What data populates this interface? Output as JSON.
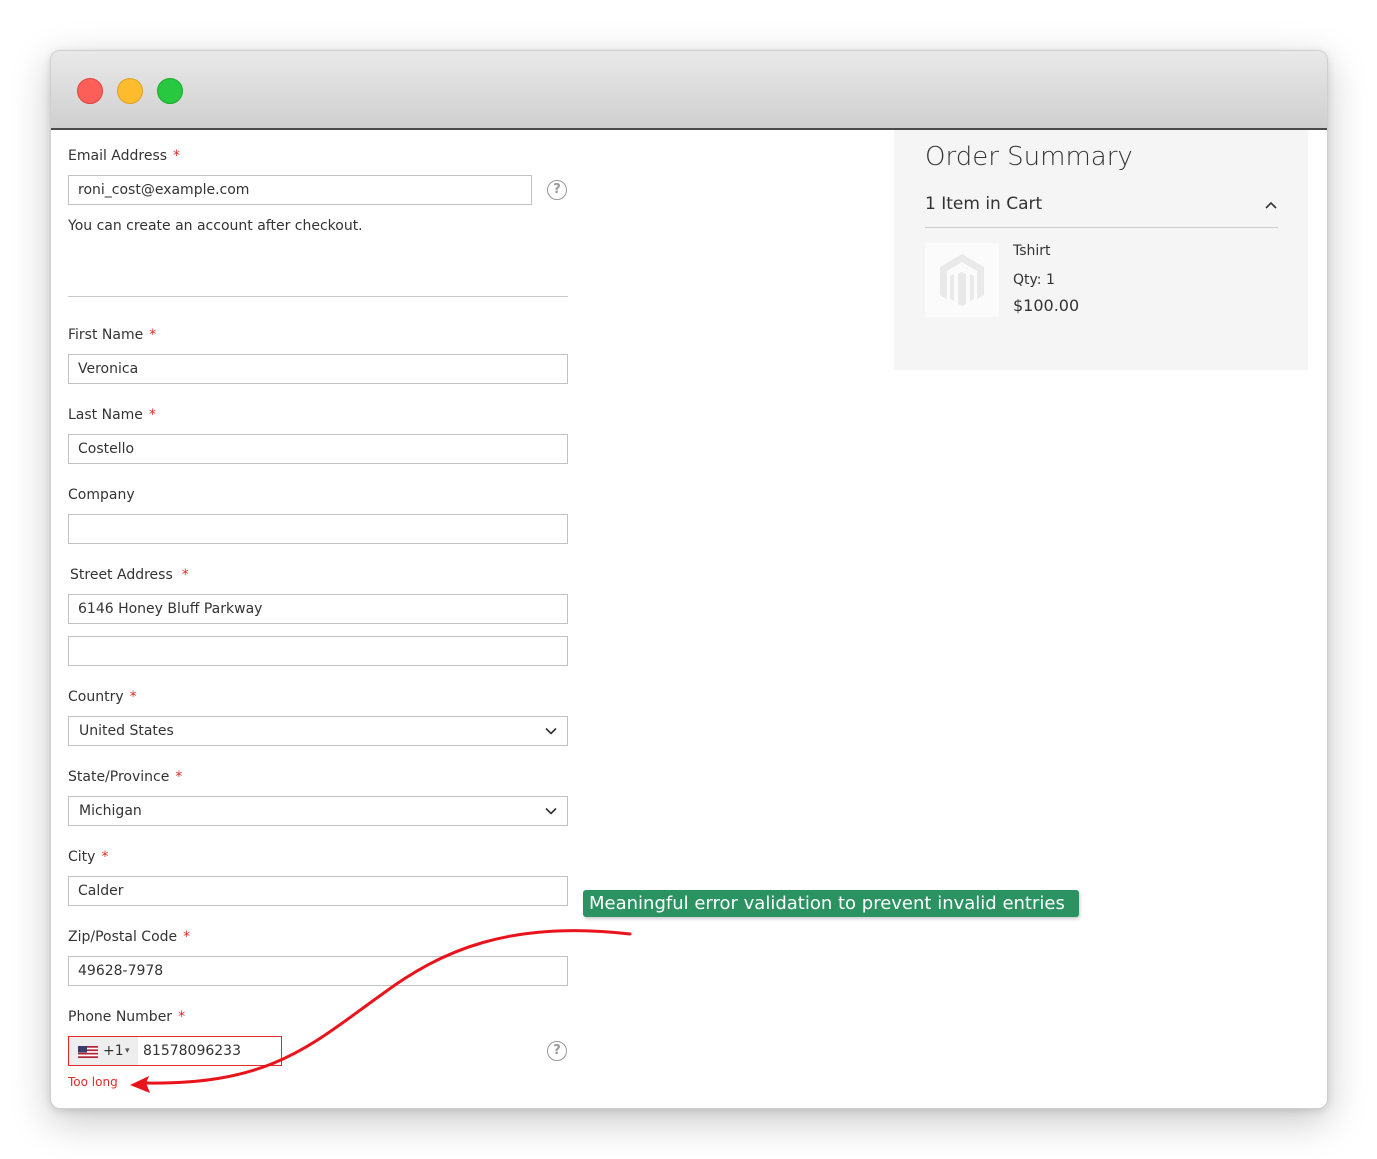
{
  "window": {
    "controls": [
      "close",
      "minimize",
      "maximize"
    ],
    "colors": {
      "close": "#fc5f57",
      "minimize": "#fdbc2e",
      "maximize": "#28c840"
    }
  },
  "form": {
    "email": {
      "label": "Email Address",
      "required": "*",
      "value": "roni_cost@example.com",
      "note": "You can create an account after checkout.",
      "help_icon": "?"
    },
    "first_name": {
      "label": "First Name",
      "required": "*",
      "value": "Veronica"
    },
    "last_name": {
      "label": "Last Name",
      "required": "*",
      "value": "Costello"
    },
    "company": {
      "label": "Company",
      "value": ""
    },
    "street": {
      "label": "Street Address",
      "required": "*",
      "line1": "6146 Honey Bluff Parkway",
      "line2": ""
    },
    "country": {
      "label": "Country",
      "required": "*",
      "value": "United States"
    },
    "state": {
      "label": "State/Province",
      "required": "*",
      "value": "Michigan"
    },
    "city": {
      "label": "City",
      "required": "*",
      "value": "Calder"
    },
    "zip": {
      "label": "Zip/Postal Code",
      "required": "*",
      "value": "49628-7978"
    },
    "phone": {
      "label": "Phone Number",
      "required": "*",
      "country_code": "+1",
      "caret": "▾",
      "value": "81578096233",
      "error": "Too long",
      "help_icon": "?"
    }
  },
  "summary": {
    "title": "Order Summary",
    "cart_count": "1 Item in Cart",
    "item": {
      "name": "Tshirt",
      "qty": "Qty: 1",
      "price": "$100.00"
    }
  },
  "annotation": {
    "text": "Meaningful error validation to prevent invalid entries",
    "color": "#2a9361",
    "arrow_color": "#e8131b"
  }
}
